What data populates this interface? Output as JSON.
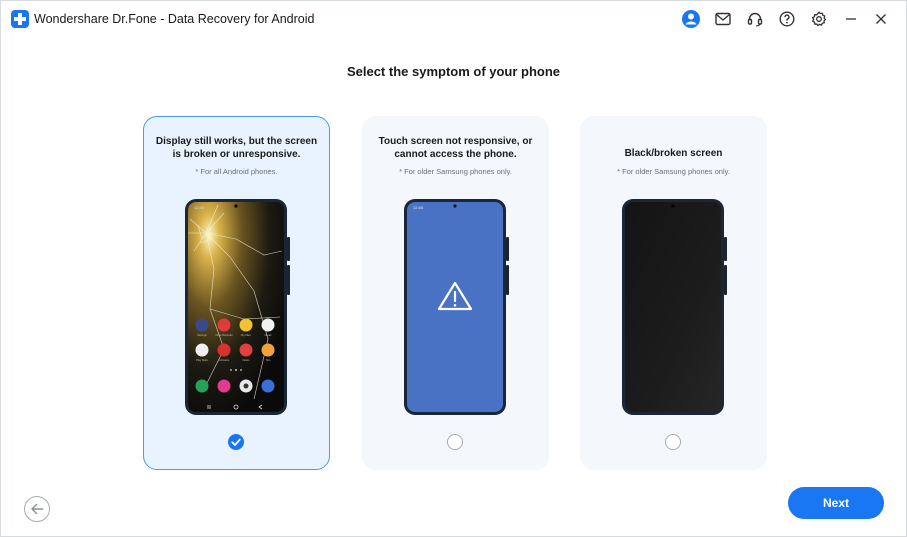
{
  "titlebar": {
    "title": "Wondershare Dr.Fone - Data Recovery for Android",
    "icons": [
      "account-icon",
      "mail-icon",
      "support-headset-icon",
      "help-icon",
      "settings-gear-icon",
      "minimize-icon",
      "close-icon"
    ]
  },
  "page": {
    "title": "Select the symptom of your phone"
  },
  "options": [
    {
      "title_line1": "Display still works, but the screen",
      "title_line2": "is broken or unresponsive.",
      "note": "* For all Android phones.",
      "selected": true,
      "image": "cracked-screen-phone-icon"
    },
    {
      "title_line1": "Touch screen not responsive, or",
      "title_line2": "cannot access the phone.",
      "note": "* For older Samsung phones only.",
      "selected": false,
      "image": "warning-screen-phone-icon"
    },
    {
      "title_line1": "Black/broken screen",
      "title_line2": "",
      "note": "* For older Samsung phones only.",
      "selected": false,
      "image": "black-screen-phone-icon"
    }
  ],
  "footer": {
    "next_label": "Next",
    "back_icon": "back-arrow-icon"
  },
  "colors": {
    "accent": "#1977f3",
    "selected_card_bg": "#e8f3ff",
    "card_bg": "#f4f7fb",
    "warning_screen": "#4a72c4"
  }
}
